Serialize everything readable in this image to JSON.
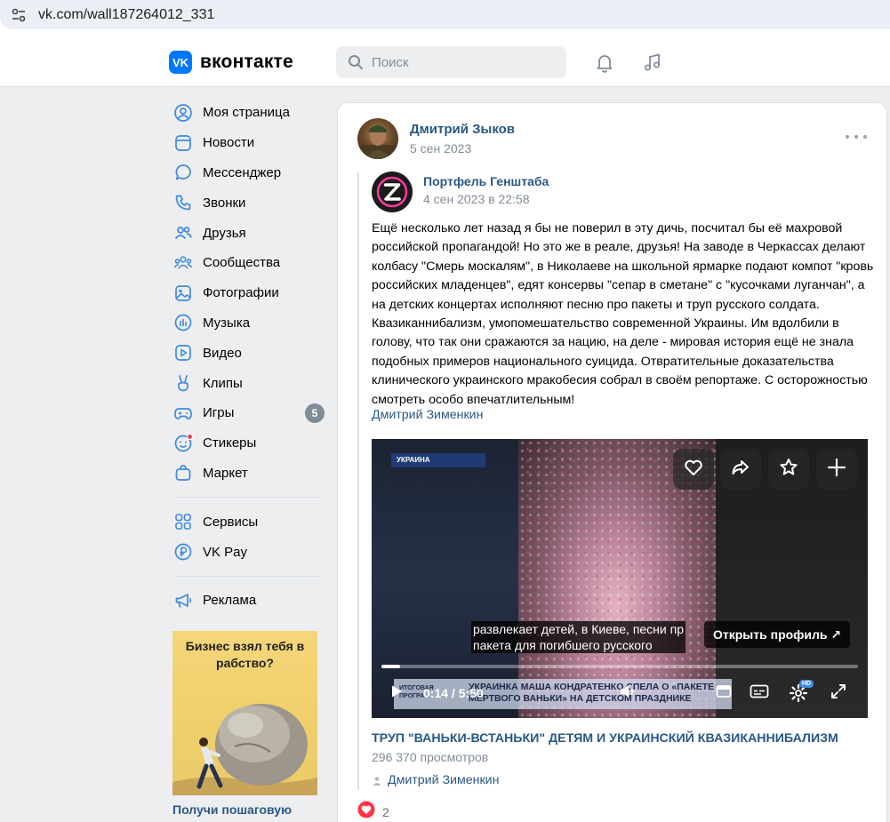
{
  "browser": {
    "url": "vk.com/wall187264012_331",
    "settings_icon": "tune-icon"
  },
  "header": {
    "logo_text": "вконтакте",
    "logo_mark": "VK",
    "search_placeholder": "Поиск",
    "brand_color": "#0077ff"
  },
  "menu": {
    "items": [
      {
        "label": "Моя страница",
        "icon": "user-circle-icon"
      },
      {
        "label": "Новости",
        "icon": "newspaper-icon"
      },
      {
        "label": "Мессенджер",
        "icon": "message-icon"
      },
      {
        "label": "Звонки",
        "icon": "phone-icon"
      },
      {
        "label": "Друзья",
        "icon": "friends-icon"
      },
      {
        "label": "Сообщества",
        "icon": "communities-icon"
      },
      {
        "label": "Фотографии",
        "icon": "photo-icon"
      },
      {
        "label": "Музыка",
        "icon": "music-icon"
      },
      {
        "label": "Видео",
        "icon": "video-icon"
      },
      {
        "label": "Клипы",
        "icon": "clips-icon"
      },
      {
        "label": "Игры",
        "icon": "gamepad-icon",
        "badge": "5"
      },
      {
        "label": "Стикеры",
        "icon": "smile-icon"
      },
      {
        "label": "Маркет",
        "icon": "bag-icon"
      }
    ],
    "services": [
      {
        "label": "Сервисы",
        "icon": "grid-icon"
      },
      {
        "label": "VK Pay",
        "icon": "ruble-icon"
      }
    ],
    "ads": [
      {
        "label": "Реклама",
        "icon": "megaphone-icon"
      }
    ]
  },
  "ad": {
    "title": "Бизнес взял тебя в рабство?",
    "caption": "Получи пошаговую"
  },
  "post": {
    "author": "Дмитрий Зыков",
    "date": "5 сен 2023",
    "repost": {
      "author": "Портфель Генштаба",
      "date": "4 сен 2023 в 22:58",
      "text": "Ещё несколько лет назад я бы не поверил в эту дичь, посчитал бы её махровой российской пропагандой! Но это же в реале, друзья! На заводе в Черкассах делают колбасу \"Смерь москалям\", в Николаеве на школьной ярмарке подают компот \"кровь российских младенцев\", едят консервы \"сепар в сметане\" с \"кусочками луганчан\", а на детских концертах исполняют песню про пакеты и труп русского солдата. Квазиканнибализм, умопомешательство современной Украины. Им вдолбили в голову, что так они сражаются за нацию, на деле - мировая история ещё не знала подобных примеров национального суицида. Отвратительные доказательства клинического украинского мракобесия собрал в своём репортаже. С осторожностью смотреть особо впечатлительным!",
      "author_link": "Дмитрий Зименкин"
    },
    "video": {
      "channel_label": "УКРАИНА",
      "subtitle_line1": "развлекает детей, в Киеве, песни пр",
      "subtitle_line2": "пакета для погибшего русского",
      "open_profile": "Открыть профиль ↗",
      "news_logo": "ИТОГОВАЯ ПРОГРА...",
      "news_text_line1": "УКРАИНКА МАША КОНДРАТЕНКО СПЕЛА О «ПАКЕТЕ",
      "news_text_line2": "МЕРТВОГО ВАНЬКИ» НА ДЕТСКОМ ПРАЗДНИКЕ",
      "time": "0:14 / 5:50",
      "progress_fraction": 0.04,
      "hd_label": "HD",
      "title": "ТРУП \"ВАНЬКИ-ВСТАНЬКИ\" ДЕТЯМ И УКРАИНСКИЙ КВАЗИКАННИБАЛИЗМ",
      "views": "296 370 просмотров",
      "author": "Дмитрий Зименкин"
    },
    "likes": "2"
  }
}
